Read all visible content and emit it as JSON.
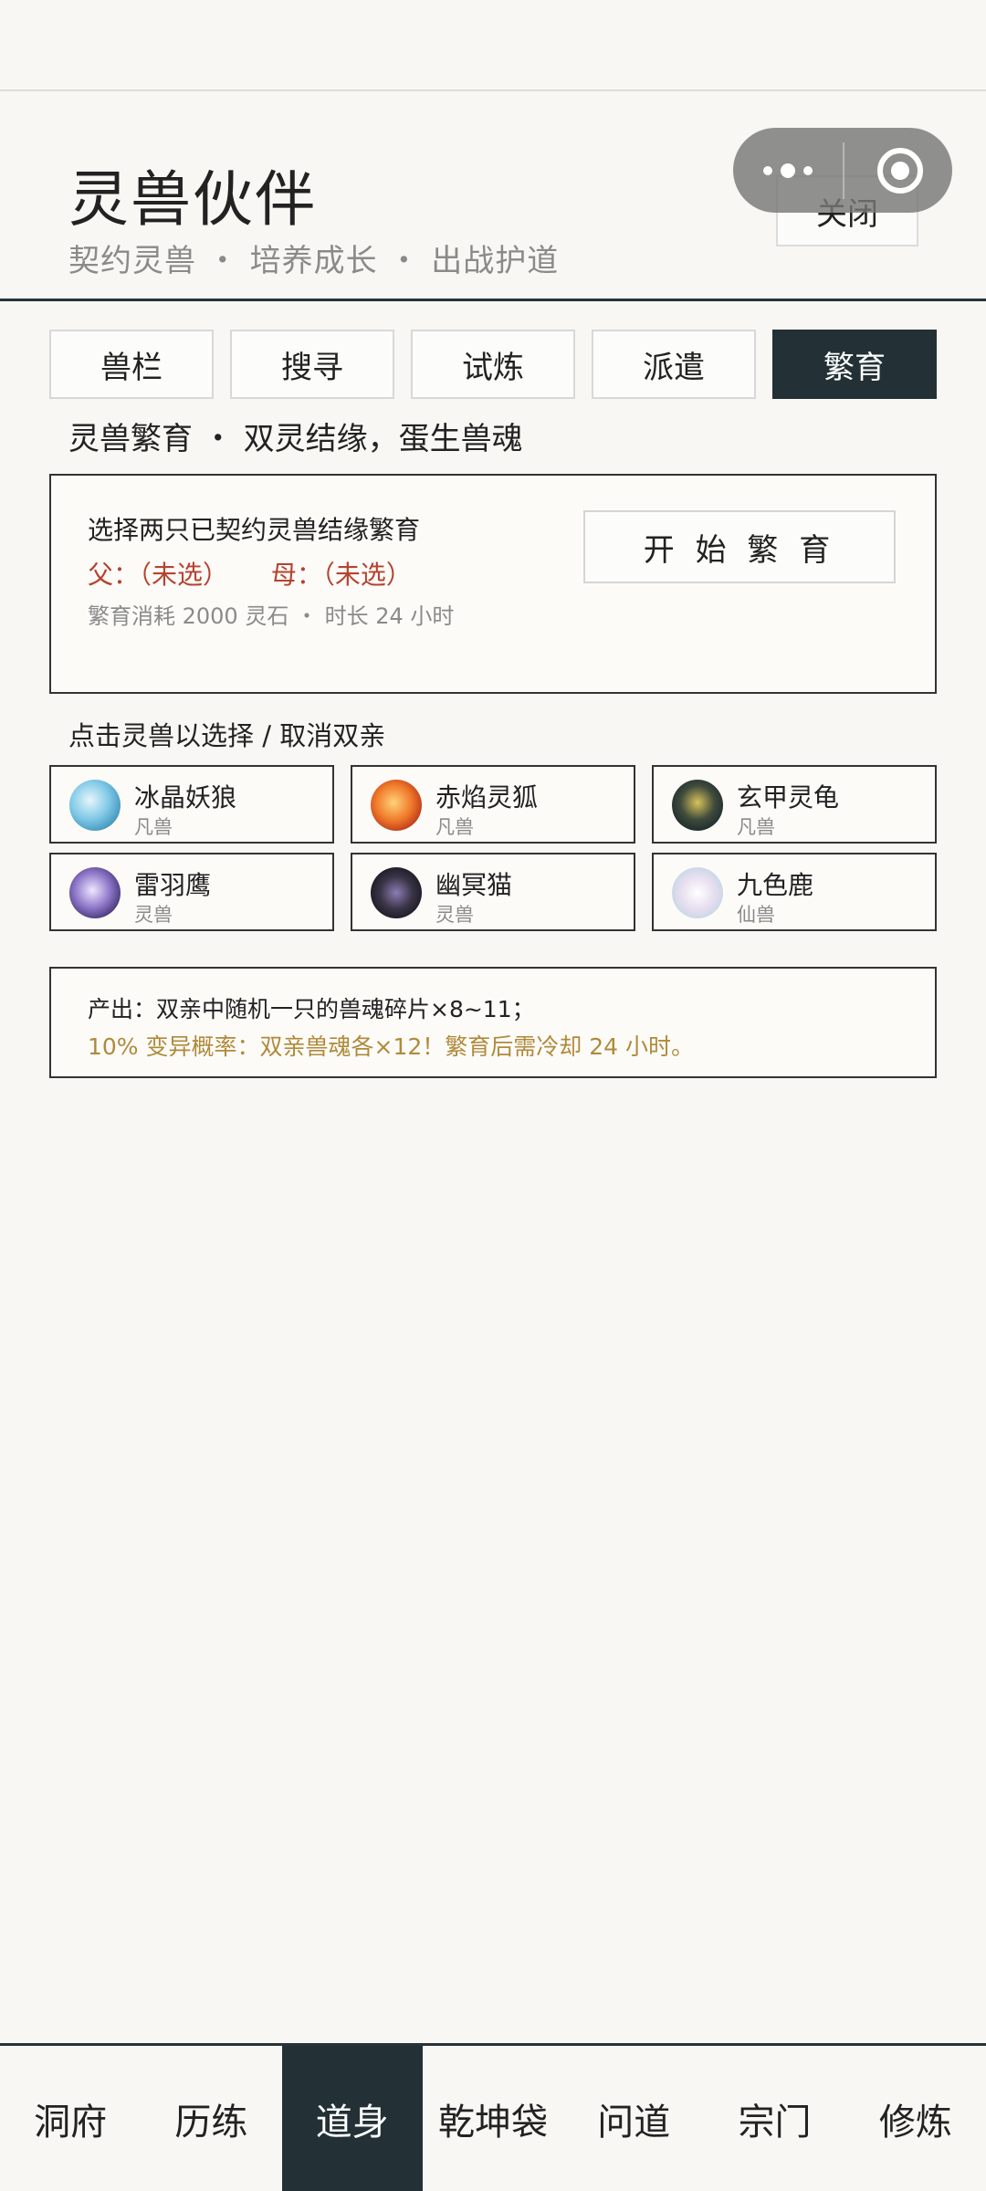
{
  "header": {
    "title": "灵兽伙伴",
    "subtitle": "契约灵兽 ・ 培养成长 ・ 出战护道",
    "close_label": "关闭"
  },
  "tabs": [
    {
      "label": "兽栏",
      "active": false
    },
    {
      "label": "搜寻",
      "active": false
    },
    {
      "label": "试炼",
      "active": false
    },
    {
      "label": "派遣",
      "active": false
    },
    {
      "label": "繁育",
      "active": true
    }
  ],
  "breed": {
    "section_title": "灵兽繁育 ・ 双灵结缘，蛋生兽魂",
    "heading": "选择两只已契约灵兽结缘繁育",
    "father": "父：（未选）",
    "mother": "母：（未选）",
    "cost": "繁育消耗 2000 灵石 ・ 时长 24 小时",
    "start_label": "开 始 繁 育",
    "hint": "点击灵兽以选择 / 取消双亲"
  },
  "beasts": [
    {
      "name": "冰晶妖狼",
      "rank": "凡兽",
      "icon": "ice-wolf-icon"
    },
    {
      "name": "赤焰灵狐",
      "rank": "凡兽",
      "icon": "fire-fox-icon"
    },
    {
      "name": "玄甲灵龟",
      "rank": "凡兽",
      "icon": "black-turtle-icon"
    },
    {
      "name": "雷羽鹰",
      "rank": "灵兽",
      "icon": "thunder-hawk-icon"
    },
    {
      "name": "幽冥猫",
      "rank": "灵兽",
      "icon": "shadow-cat-icon"
    },
    {
      "name": "九色鹿",
      "rank": "仙兽",
      "icon": "nine-color-deer-icon"
    }
  ],
  "output": {
    "line1": "产出：双亲中随机一只的兽魂碎片×8~11；",
    "line2": "10% 变异概率：双亲兽魂各×12！繁育后需冷却 24 小时。"
  },
  "bottom_nav": [
    {
      "label": "洞府",
      "active": false
    },
    {
      "label": "历练",
      "active": false
    },
    {
      "label": "道身",
      "active": true
    },
    {
      "label": "乾坤袋",
      "active": false
    },
    {
      "label": "问道",
      "active": false
    },
    {
      "label": "宗门",
      "active": false
    },
    {
      "label": "修炼",
      "active": false
    }
  ],
  "colors": {
    "accent_dark": "#233136",
    "parent_red": "#b5432f",
    "mutation_gold": "#b08a3a"
  }
}
